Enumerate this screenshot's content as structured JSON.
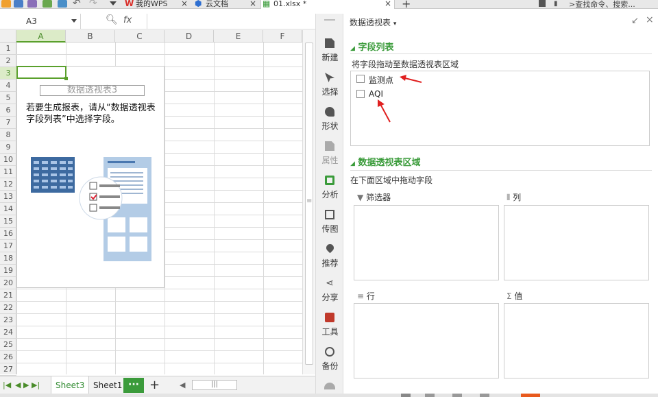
{
  "tabs": [
    {
      "label": "我的WPS",
      "icon": "wps-icon",
      "color": "#d9302b"
    },
    {
      "label": "云文档",
      "icon": "cloud-doc-icon",
      "color": "#2e6fd1"
    },
    {
      "label": "01.xlsx *",
      "icon": "spreadsheet-icon",
      "color": "#3a9b3a"
    }
  ],
  "search_placeholder": ">查找命令、搜索...",
  "namebox": {
    "value": "A3"
  },
  "formula": {
    "fx": "fx"
  },
  "columns": [
    "A",
    "B",
    "C",
    "D",
    "E",
    "F"
  ],
  "rows": [
    "1",
    "2",
    "3",
    "4",
    "5",
    "6",
    "7",
    "8",
    "9",
    "10",
    "11",
    "12",
    "13",
    "14",
    "15",
    "16",
    "17",
    "18",
    "19",
    "20",
    "21",
    "22",
    "23",
    "24",
    "25",
    "26",
    "27"
  ],
  "pivot": {
    "title": "数据透视表3",
    "hint": "若要生成报表，请从“数据透视表字段列表”中选择字段。"
  },
  "sheets": {
    "active": "Sheet3",
    "other": "Sheet1",
    "more": "···",
    "add": "+",
    "scroll": "|||"
  },
  "side_tools": [
    {
      "label": "新建",
      "icon": "new-file-icon",
      "disabled": false
    },
    {
      "label": "选择",
      "icon": "select-cursor-icon",
      "disabled": false
    },
    {
      "label": "形状",
      "icon": "shapes-icon",
      "disabled": false
    },
    {
      "label": "属性",
      "icon": "properties-icon",
      "disabled": true
    },
    {
      "label": "分析",
      "icon": "analyze-icon",
      "disabled": false
    },
    {
      "label": "传图",
      "icon": "image-upload-icon",
      "disabled": false
    },
    {
      "label": "推荐",
      "icon": "recommend-icon",
      "disabled": false
    },
    {
      "label": "分享",
      "icon": "share-icon",
      "disabled": false
    },
    {
      "label": "工具",
      "icon": "toolbox-icon",
      "disabled": false
    },
    {
      "label": "备份",
      "icon": "backup-icon",
      "disabled": false
    }
  ],
  "panel": {
    "title": "数据透视表",
    "fields_section": "字段列表",
    "fields_hint": "将字段拖动至数据透视表区域",
    "fields": [
      "监测点",
      "AQI"
    ],
    "areas_section": "数据透视表区域",
    "areas_hint": "在下面区域中拖动字段",
    "areas": {
      "filter": "筛选器",
      "columns": "列",
      "rows": "行",
      "values": "值"
    }
  },
  "colors": {
    "accent": "#3a9b3a",
    "arrow": "#e02020"
  }
}
